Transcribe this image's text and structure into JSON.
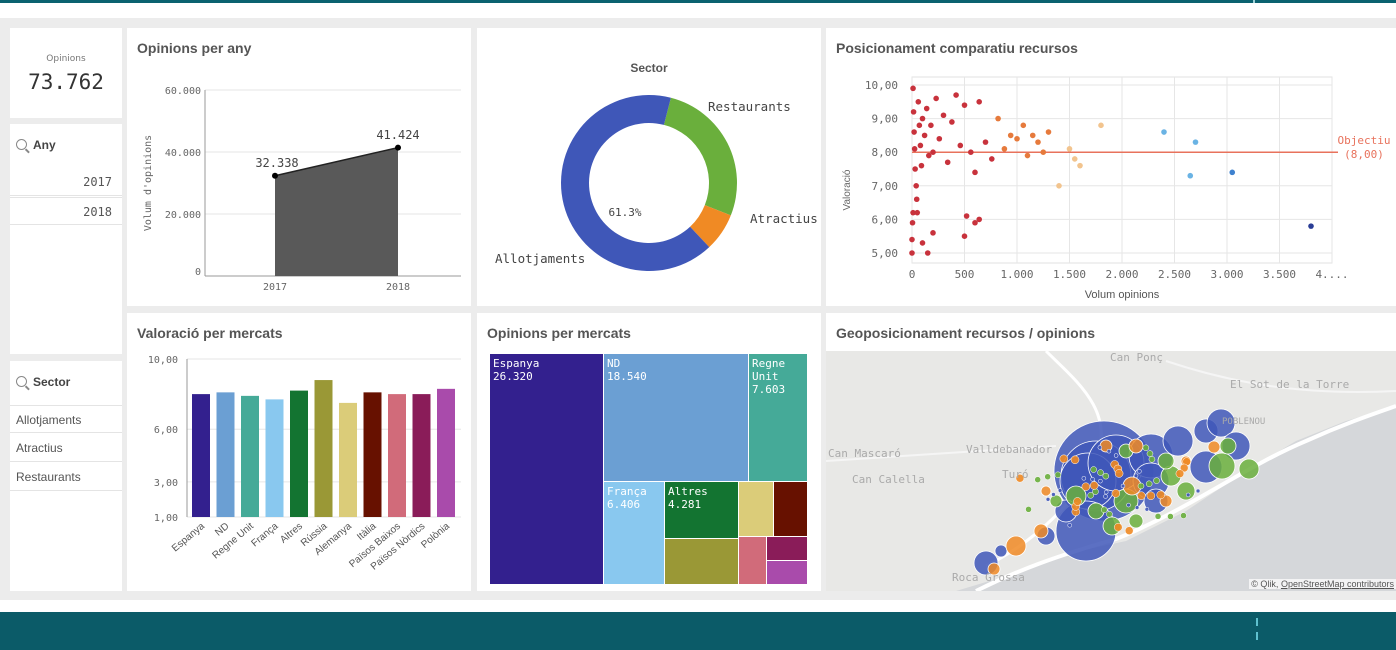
{
  "kpi": {
    "label": "Opinions",
    "value": "73.762"
  },
  "filters": {
    "any": {
      "title": "Any",
      "items": [
        "2017",
        "2018"
      ]
    },
    "sector": {
      "title": "Sector",
      "items": [
        "Allotjaments",
        "Atractius",
        "Restaurants"
      ]
    }
  },
  "opinions_per_any": {
    "title": "Opinions per any",
    "ylabel": "Volum d'opinions",
    "yticks": [
      "60.000",
      "40.000",
      "20.000",
      "0"
    ],
    "xticks": [
      "2017",
      "2018"
    ],
    "labels": [
      "32.338",
      "41.424"
    ]
  },
  "sector": {
    "title": "Sector",
    "labels": {
      "restaurants": "Restaurants",
      "atractius": "Atractius",
      "allotjaments": "Allotjaments"
    },
    "center_label": "61.3%"
  },
  "posicionament": {
    "title": "Posicionament comparatiu recursos",
    "ylabel": "Valoració",
    "xlabel": "Volum opinions",
    "yticks": [
      "10,00",
      "9,00",
      "8,00",
      "7,00",
      "6,00",
      "5,00"
    ],
    "xticks": [
      "0",
      "500",
      "1.000",
      "1.500",
      "2.000",
      "2.500",
      "3.000",
      "3.500",
      "4...."
    ],
    "objective_label": "Objectiu",
    "objective_value": "(8,00)"
  },
  "valoracio": {
    "title": "Valoració per mercats",
    "yticks": [
      "10,00",
      "6,00",
      "3,00",
      "1,00"
    ]
  },
  "opinions_mercats": {
    "title": "Opinions per mercats",
    "cells": [
      {
        "name": "Espanya",
        "value": "26.320"
      },
      {
        "name": "ND",
        "value": "18.540"
      },
      {
        "name": "Regne Unit",
        "value": "7.603"
      },
      {
        "name": "França",
        "value": "6.406"
      },
      {
        "name": "Altres",
        "value": "4.281"
      }
    ]
  },
  "geo": {
    "title": "Geoposicionament recursos / opinions",
    "places": [
      "Can Ponç",
      "El Sot de la Torre",
      "POBLENOU",
      "Can Mascaró",
      "Valldebanador",
      "Can Calella",
      "Turó",
      "Roca Grossa"
    ],
    "attribution_prefix": "© Qlik, ",
    "attribution_link": "OpenStreetMap contributors"
  },
  "chart_data": [
    {
      "type": "area",
      "title": "Opinions per any",
      "categories": [
        "2017",
        "2018"
      ],
      "values": [
        32338,
        41424
      ],
      "ylabel": "Volum d'opinions",
      "ylim": [
        0,
        60000
      ],
      "color": "#595959"
    },
    {
      "type": "pie",
      "title": "Sector",
      "donut": true,
      "categories": [
        "Restaurants",
        "Atractius",
        "Allotjaments"
      ],
      "values": [
        27.0,
        7.0,
        66.0
      ],
      "colors": [
        "#6aaf3c",
        "#f08a24",
        "#3f57b8"
      ],
      "center_label": "61.3%"
    },
    {
      "type": "scatter",
      "title": "Posicionament comparatiu recursos",
      "xlabel": "Volum opinions",
      "ylabel": "Valoració",
      "xlim": [
        0,
        4000
      ],
      "ylim": [
        5,
        10
      ],
      "reference_line": {
        "label": "Objectiu",
        "value": 8.0,
        "color": "#e8725c"
      },
      "series": [
        {
          "name": "",
          "x": [
            10,
            15,
            20,
            25,
            30,
            40,
            45,
            50,
            60,
            70,
            80,
            90,
            100,
            120,
            140,
            160,
            180,
            200,
            230,
            260,
            300,
            340,
            380,
            420,
            460,
            500,
            560,
            600,
            640,
            700,
            760,
            820,
            880,
            940,
            1000,
            1060,
            1100,
            1150,
            1200,
            1250,
            1300,
            1400,
            1500,
            1550,
            1600,
            1800,
            2400,
            2700,
            2650,
            3050,
            3800,
            0,
            0,
            5,
            10,
            100,
            150,
            200,
            500,
            520,
            600,
            640
          ],
          "y": [
            9.9,
            9.2,
            8.6,
            8.1,
            7.5,
            7.0,
            6.6,
            6.2,
            9.5,
            8.8,
            8.2,
            7.6,
            9.0,
            8.5,
            9.3,
            7.9,
            8.8,
            8.0,
            9.6,
            8.4,
            9.1,
            7.7,
            8.9,
            9.7,
            8.2,
            9.4,
            8.0,
            7.4,
            9.5,
            8.3,
            7.8,
            9.0,
            8.1,
            8.5,
            8.4,
            8.8,
            7.9,
            8.5,
            8.3,
            8.0,
            8.6,
            7.0,
            8.1,
            7.8,
            7.6,
            8.8,
            8.6,
            8.3,
            7.3,
            7.4,
            5.8,
            5.0,
            5.4,
            5.9,
            6.2,
            5.3,
            5.0,
            5.6,
            5.5,
            6.1,
            5.9,
            6.0
          ]
        }
      ]
    },
    {
      "type": "bar",
      "title": "Valoració per mercats",
      "categories": [
        "Espanya",
        "ND",
        "Regne Unit",
        "França",
        "Altres",
        "Rússia",
        "Alemanya",
        "Itàlia",
        "Països Baixos",
        "Països Nòrdics",
        "Polònia"
      ],
      "values": [
        8.0,
        8.1,
        7.9,
        7.7,
        8.2,
        8.8,
        7.5,
        8.1,
        8.0,
        8.0,
        8.3
      ],
      "colors": [
        "#33208e",
        "#6b9fd3",
        "#45aa98",
        "#89c8ef",
        "#137431",
        "#9a9836",
        "#dbcc79",
        "#671100",
        "#d16b7a",
        "#8a1c59",
        "#a94bab"
      ],
      "ylim": [
        1,
        10
      ]
    },
    {
      "type": "treemap",
      "title": "Opinions per mercats",
      "categories": [
        "Espanya",
        "ND",
        "Regne Unit",
        "França",
        "Altres"
      ],
      "values": [
        26320,
        18540,
        7603,
        6406,
        4281
      ]
    }
  ]
}
